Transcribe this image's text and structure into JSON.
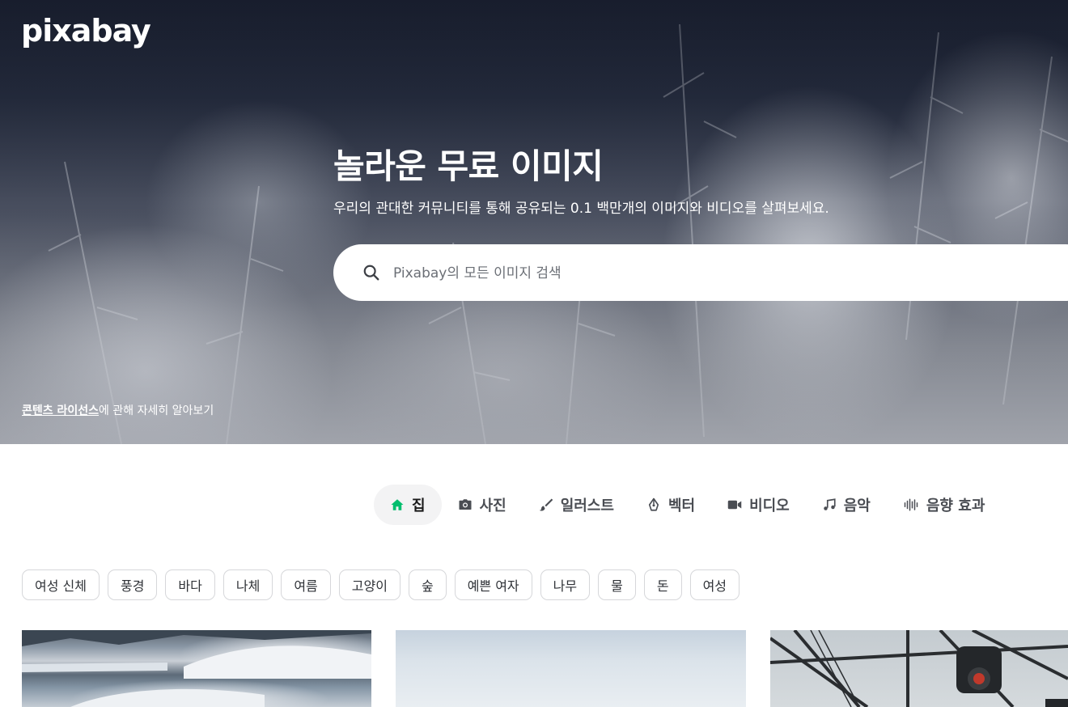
{
  "brand": {
    "logo_text": "pixabay"
  },
  "hero": {
    "title": "놀라운 무료 이미지",
    "subtitle": "우리의 관대한 커뮤니티를 통해 공유되는 0.1 백만개의 이미지와 비디오를 살펴보세요.",
    "search": {
      "placeholder": "Pixabay의 모든 이미지 검색",
      "value": ""
    },
    "license": {
      "link_text": "콘텐츠 라이선스",
      "rest_text": "에 관해 자세히 알아보기"
    }
  },
  "tabs": [
    {
      "label": "집",
      "icon": "home-icon",
      "active": true
    },
    {
      "label": "사진",
      "icon": "camera-icon",
      "active": false
    },
    {
      "label": "일러스트",
      "icon": "brush-icon",
      "active": false
    },
    {
      "label": "벡터",
      "icon": "pen-nib-icon",
      "active": false
    },
    {
      "label": "비디오",
      "icon": "video-camera-icon",
      "active": false
    },
    {
      "label": "음악",
      "icon": "music-note-icon",
      "active": false
    },
    {
      "label": "음향 효과",
      "icon": "sound-wave-icon",
      "active": false
    }
  ],
  "chips": [
    "여성 신체",
    "풍경",
    "바다",
    "나체",
    "여름",
    "고양이",
    "숲",
    "예쁜 여자",
    "나무",
    "물",
    "돈",
    "여성"
  ],
  "colors": {
    "accent": "#02be6e",
    "tab_active_bg": "#f3f3f4",
    "text": "#4a4d53"
  }
}
